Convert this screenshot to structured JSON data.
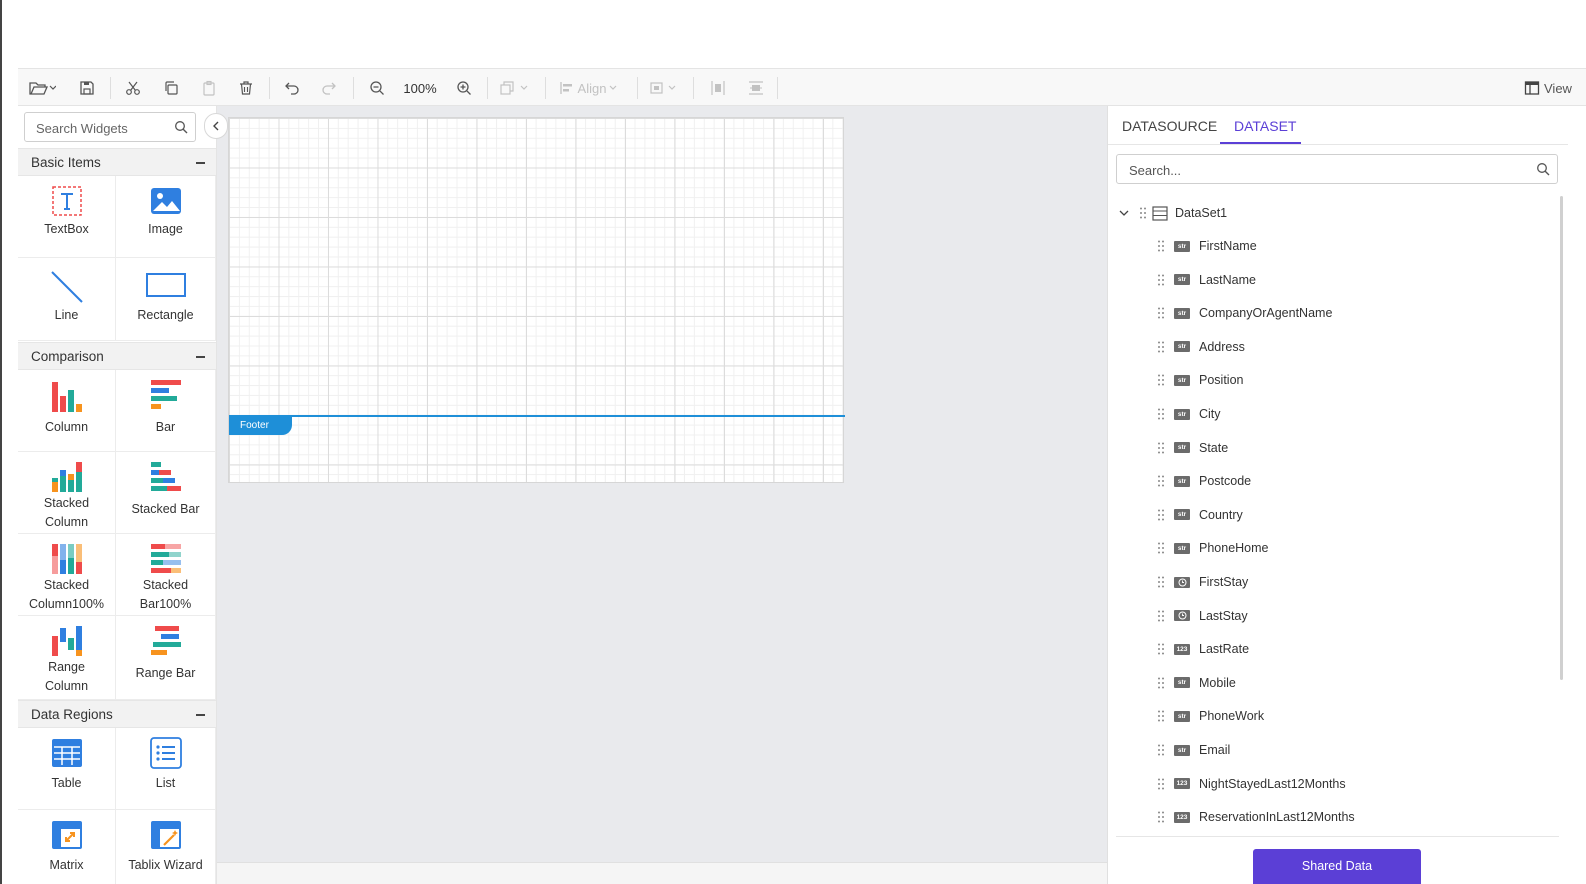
{
  "toolbar": {
    "zoom_level": "100%",
    "align_label": "Align",
    "view_label": "View"
  },
  "widgets": {
    "search_placeholder": "Search Widgets",
    "categories": [
      {
        "name": "Basic Items",
        "items": [
          "TextBox",
          "Image",
          "Line",
          "Rectangle"
        ]
      },
      {
        "name": "Comparison",
        "items": [
          "Column",
          "Bar",
          "Stacked Column",
          "Stacked Bar",
          "Stacked Column100%",
          "Stacked Bar100%",
          "Range Column",
          "Range Bar"
        ]
      },
      {
        "name": "Data Regions",
        "items": [
          "Table",
          "List",
          "Matrix",
          "Tablix Wizard"
        ]
      }
    ]
  },
  "canvas": {
    "footer_label": "Footer"
  },
  "data_panel": {
    "tabs": [
      "DATASOURCE",
      "DATASET"
    ],
    "active_tab": "DATASET",
    "search_placeholder": "Search...",
    "dataset_name": "DataSet1",
    "fields": [
      {
        "name": "FirstName",
        "type": "str"
      },
      {
        "name": "LastName",
        "type": "str"
      },
      {
        "name": "CompanyOrAgentName",
        "type": "str"
      },
      {
        "name": "Address",
        "type": "str"
      },
      {
        "name": "Position",
        "type": "str"
      },
      {
        "name": "City",
        "type": "str"
      },
      {
        "name": "State",
        "type": "str"
      },
      {
        "name": "Postcode",
        "type": "str"
      },
      {
        "name": "Country",
        "type": "str"
      },
      {
        "name": "PhoneHome",
        "type": "str"
      },
      {
        "name": "FirstStay",
        "type": "clock"
      },
      {
        "name": "LastStay",
        "type": "clock"
      },
      {
        "name": "LastRate",
        "type": "123"
      },
      {
        "name": "Mobile",
        "type": "str"
      },
      {
        "name": "PhoneWork",
        "type": "str"
      },
      {
        "name": "Email",
        "type": "str"
      },
      {
        "name": "NightStayedLast12Months",
        "type": "123"
      },
      {
        "name": "ReservationInLast12Months",
        "type": "123"
      }
    ],
    "shared_button": "Shared Data"
  },
  "colors": {
    "accent": "#5b3fd6",
    "footer_blue": "#1e8fd8",
    "chart_red": "#ef4b4b",
    "chart_teal": "#22aa99",
    "chart_blue": "#2f7fe0",
    "chart_orange": "#f7931e"
  }
}
